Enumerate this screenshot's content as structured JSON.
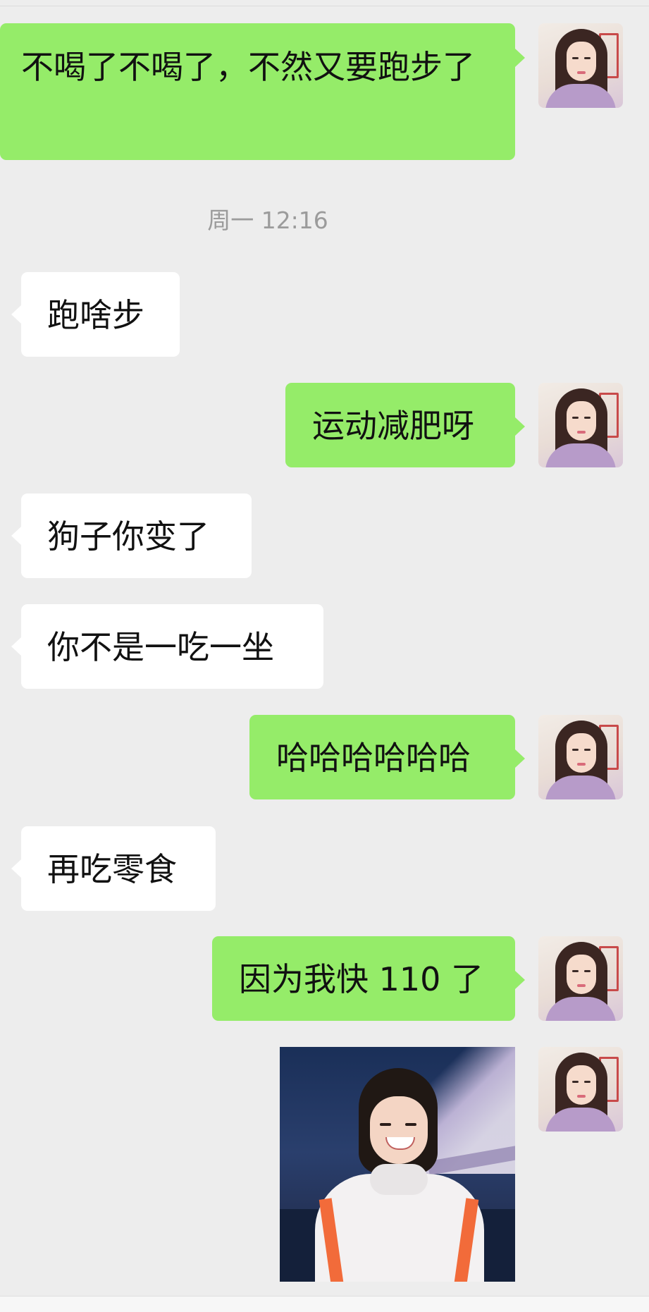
{
  "chat": {
    "timestamp": "周一 12:16",
    "messages": [
      {
        "sender": "me",
        "text": "不喝了不喝了，不然又要跑步了"
      },
      {
        "sender": "friend",
        "text": "跑啥步"
      },
      {
        "sender": "me",
        "text": "运动减肥呀"
      },
      {
        "sender": "friend",
        "text": "狗子你变了"
      },
      {
        "sender": "friend",
        "text": "你不是一吃一坐"
      },
      {
        "sender": "me",
        "text": "哈哈哈哈哈哈"
      },
      {
        "sender": "friend",
        "text": "再吃零食"
      },
      {
        "sender": "me",
        "text": "因为我快 110 了"
      },
      {
        "sender": "me",
        "type": "sticker",
        "sticker": "smiling-woman-sticker"
      }
    ]
  },
  "icons": {
    "avatar": "woman-portrait-avatar"
  },
  "colors": {
    "background": "#ededed",
    "outgoing_bubble": "#95ec69",
    "incoming_bubble": "#ffffff",
    "timestamp_text": "#9b9b9b"
  }
}
